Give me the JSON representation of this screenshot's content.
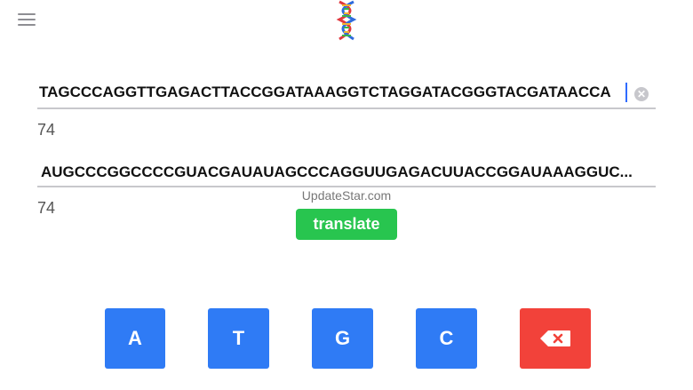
{
  "dna": {
    "sequence": "TAGCCCAGGTTGAGACTTACCGGATAAAGGTCTAGGATACGGGTACGATAACCA",
    "count": "74"
  },
  "rna": {
    "sequence": "AUGCCCGGCCCCGUACGAUAUAGCCCAGGUUGAGACUUACCGGAUAAAGGUC...",
    "count": "74"
  },
  "watermark": "UpdateStar.com",
  "translate_label": "translate",
  "keys": [
    "A",
    "T",
    "G",
    "C"
  ],
  "icons": {
    "menu": "hamburger-icon",
    "logo": "dna-helix-icon",
    "clear": "clear-circle-icon",
    "delete": "backspace-icon"
  },
  "colors": {
    "key_blue": "#2f7bf5",
    "delete_red": "#f2423a",
    "translate_green": "#28c54f",
    "caret_blue": "#2f6bff"
  }
}
